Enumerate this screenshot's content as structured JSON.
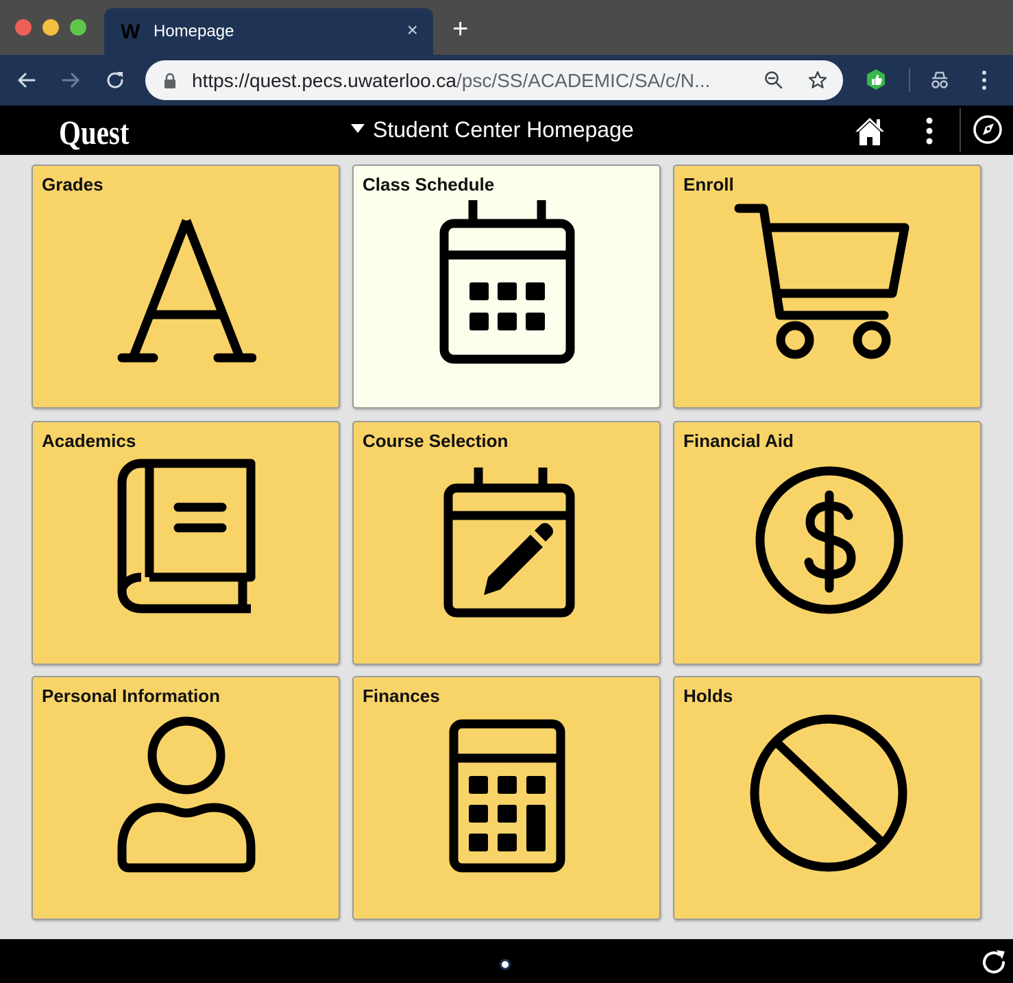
{
  "browser": {
    "tab": {
      "favicon": "W",
      "title": "Homepage",
      "close": "×"
    },
    "new_tab": "+",
    "url": {
      "main": "https://quest.pecs.uwaterloo.ca",
      "path": "/psc/SS/ACADEMIC/SA/c/N..."
    }
  },
  "header": {
    "brand": "Quest",
    "page_title": "Student Center Homepage"
  },
  "tiles": [
    {
      "label": "Grades",
      "icon": "letter-a-icon"
    },
    {
      "label": "Class Schedule",
      "icon": "calendar-icon"
    },
    {
      "label": "Enroll",
      "icon": "shopping-cart-icon"
    },
    {
      "label": "Academics",
      "icon": "book-icon"
    },
    {
      "label": "Course Selection",
      "icon": "calendar-edit-icon"
    },
    {
      "label": "Financial Aid",
      "icon": "dollar-circle-icon"
    },
    {
      "label": "Personal Information",
      "icon": "person-icon"
    },
    {
      "label": "Finances",
      "icon": "calculator-icon"
    },
    {
      "label": "Holds",
      "icon": "prohibited-icon"
    }
  ],
  "colors": {
    "tile": "#f8d468",
    "tile_selected": "#fefeec",
    "header": "#000000",
    "browser_chrome": "#1f3455"
  }
}
